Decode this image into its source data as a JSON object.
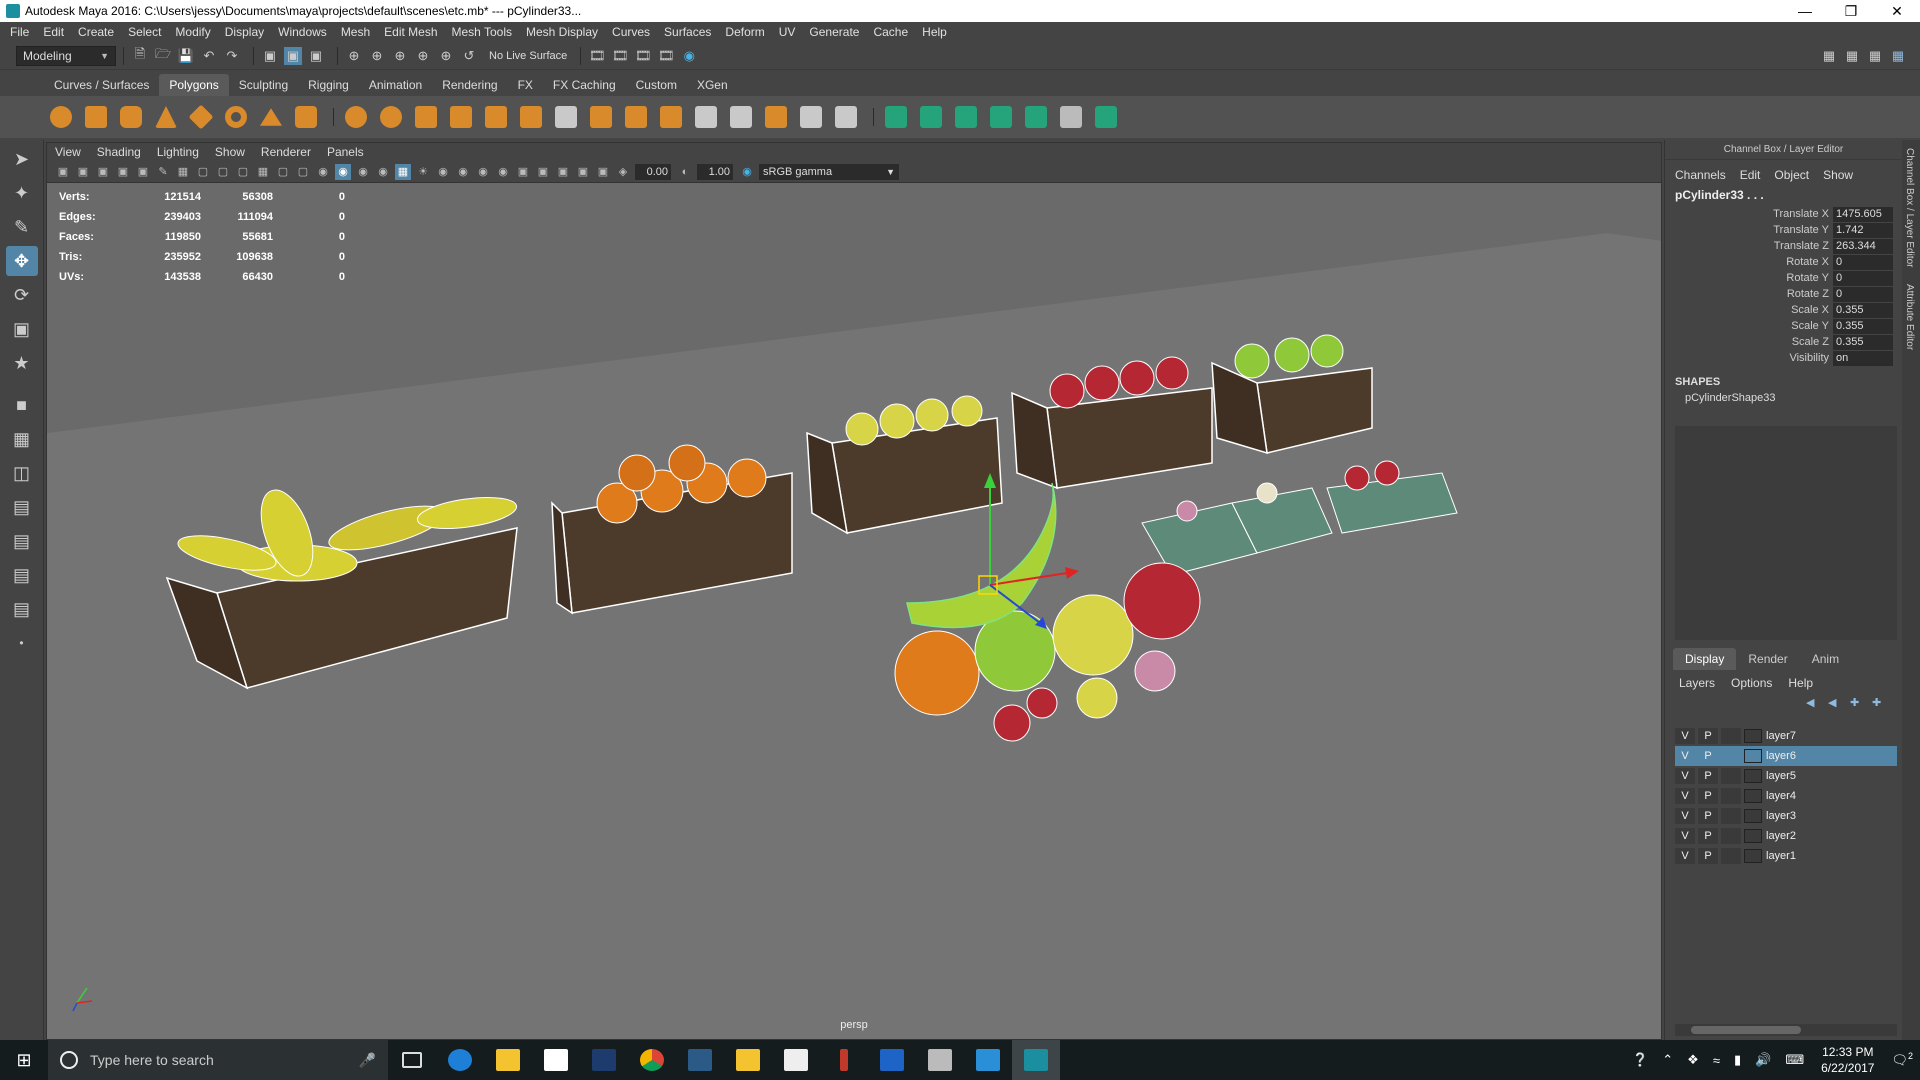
{
  "window": {
    "title": "Autodesk Maya 2016: C:\\Users\\jessy\\Documents\\maya\\projects\\default\\scenes\\etc.mb*  ---  pCylinder33..."
  },
  "menubar": [
    "File",
    "Edit",
    "Create",
    "Select",
    "Modify",
    "Display",
    "Windows",
    "Mesh",
    "Edit Mesh",
    "Mesh Tools",
    "Mesh Display",
    "Curves",
    "Surfaces",
    "Deform",
    "UV",
    "Generate",
    "Cache",
    "Help"
  ],
  "statusline": {
    "mode": "Modeling",
    "live_surface": "No Live Surface"
  },
  "shelf": {
    "tabs": [
      "Curves / Surfaces",
      "Polygons",
      "Sculpting",
      "Rigging",
      "Animation",
      "Rendering",
      "FX",
      "FX Caching",
      "Custom",
      "XGen"
    ],
    "active_tab": "Polygons"
  },
  "viewport": {
    "menu": [
      "View",
      "Shading",
      "Lighting",
      "Show",
      "Renderer",
      "Panels"
    ],
    "exposure": "0.00",
    "gamma": "1.00",
    "color_space": "sRGB gamma",
    "camera": "persp",
    "hud": [
      {
        "label": "Verts:",
        "a": "121514",
        "b": "56308",
        "c": "0"
      },
      {
        "label": "Edges:",
        "a": "239403",
        "b": "111094",
        "c": "0"
      },
      {
        "label": "Faces:",
        "a": "119850",
        "b": "55681",
        "c": "0"
      },
      {
        "label": "Tris:",
        "a": "235952",
        "b": "109638",
        "c": "0"
      },
      {
        "label": "UVs:",
        "a": "143538",
        "b": "66430",
        "c": "0"
      }
    ]
  },
  "channel_box": {
    "header": "Channel Box / Layer Editor",
    "menu": [
      "Channels",
      "Edit",
      "Object",
      "Show"
    ],
    "object": "pCylinder33 . . .",
    "attributes": [
      {
        "name": "Translate X",
        "value": "1475.605"
      },
      {
        "name": "Translate Y",
        "value": "1.742"
      },
      {
        "name": "Translate Z",
        "value": "263.344"
      },
      {
        "name": "Rotate X",
        "value": "0"
      },
      {
        "name": "Rotate Y",
        "value": "0"
      },
      {
        "name": "Rotate Z",
        "value": "0"
      },
      {
        "name": "Scale X",
        "value": "0.355"
      },
      {
        "name": "Scale Y",
        "value": "0.355"
      },
      {
        "name": "Scale Z",
        "value": "0.355"
      },
      {
        "name": "Visibility",
        "value": "on"
      }
    ],
    "shapes_label": "SHAPES",
    "shape": "pCylinderShape33"
  },
  "layer_editor": {
    "tabs": [
      "Display",
      "Render",
      "Anim"
    ],
    "active_tab": "Display",
    "menu": [
      "Layers",
      "Options",
      "Help"
    ],
    "layers": [
      {
        "v": "V",
        "p": "P",
        "name": "layer7",
        "selected": false
      },
      {
        "v": "V",
        "p": "P",
        "name": "layer6",
        "selected": true
      },
      {
        "v": "V",
        "p": "P",
        "name": "layer5",
        "selected": false
      },
      {
        "v": "V",
        "p": "P",
        "name": "layer4",
        "selected": false
      },
      {
        "v": "V",
        "p": "P",
        "name": "layer3",
        "selected": false
      },
      {
        "v": "V",
        "p": "P",
        "name": "layer2",
        "selected": false
      },
      {
        "v": "V",
        "p": "P",
        "name": "layer1",
        "selected": false
      }
    ]
  },
  "side_tabs": [
    "Channel Box / Layer Editor",
    "Attribute Editor"
  ],
  "taskbar": {
    "search_placeholder": "Type here to search",
    "time": "12:33 PM",
    "date": "6/22/2017",
    "notifications": "2"
  },
  "colors": {
    "accent": "#5285a6",
    "panel": "#444444",
    "viewport_bg": "#6b6b6b"
  }
}
